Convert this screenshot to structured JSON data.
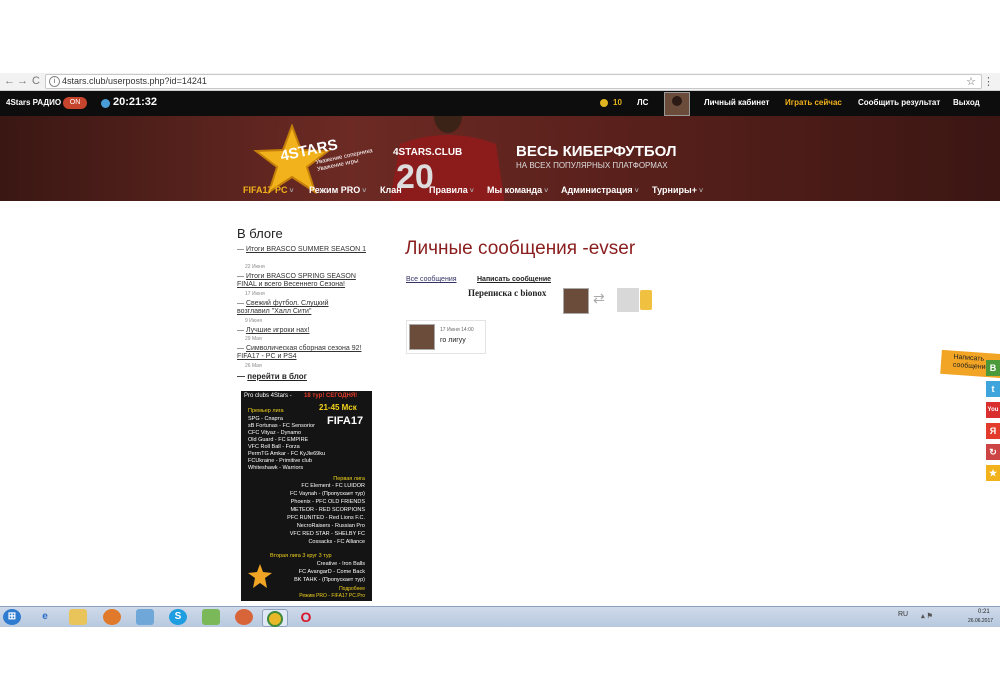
{
  "browser": {
    "url": "4stars.club/userposts.php?id=14241",
    "back": "←",
    "forward": "→",
    "reload": "C"
  },
  "topbar": {
    "radio_label": "4Stars РАДИО",
    "radio_button": "ON",
    "time": "20:21:32",
    "coins": "10",
    "ls": "ЛС",
    "nav": [
      "Личный кабинет",
      "Играть сейчас",
      "Сообщить результат",
      "Выход"
    ],
    "highlight_color": "#f2b21c"
  },
  "banner": {
    "logo": "4STARS",
    "slogan": [
      "Уважение соперника",
      "Уважение игры"
    ],
    "shirt_text": "4STARS.CLUB",
    "shirt_number": "20",
    "title": "ВЕСЬ КИБЕРФУТБОЛ",
    "subtitle": "НА ВСЕХ ПОПУЛЯРНЫХ ПЛАТФОРМАХ",
    "nav": [
      "FIFA17 PC",
      "Режим PRO",
      "Клан",
      "Правила",
      "Мы команда",
      "Администрация",
      "Турниры+"
    ],
    "active_color": "#f2b21c"
  },
  "sidebar": {
    "title": "В блоге",
    "items": [
      {
        "title": "Итоги BRASCO SUMMER SEASON 1",
        "date": "22 Июня"
      },
      {
        "title": "Итоги BRASCO SPRING SEASON FINAL и всего Весеннего Сезона!",
        "date": "17 Июня"
      },
      {
        "title": "Свежий футбол. Слуцкий возглавил \"Халл Сити\"",
        "date": "9 Июня"
      },
      {
        "title": "Лучшие игроки нах!",
        "date": "29 Мая"
      },
      {
        "title": "Символическая сборная сезона 92! FIFA17 - PC и PS4",
        "date": "26 Мая"
      }
    ],
    "to_blog": "перейти в блог"
  },
  "poster": {
    "header": "Pro clubs 4Stars -",
    "header_highlight": "18 тур! СЕГОДНЯ!",
    "time": "21-45 Мск",
    "game": "FIFA17",
    "premier_label": "Премьер лига",
    "premier": [
      "SPG - Спарта",
      "sB Fortunas - FC Sensorior",
      "CFC Vityaz - Dynamo",
      "Old Guard - FC EMPIRE",
      "VFC Roll Ball - Forza",
      "PermTG Amkar - FC KyJle69ku",
      "FCUkraine - Primitive club",
      "Whiteshawk - Warriors"
    ],
    "first_label": "Первая лига",
    "first": [
      "FC Element - FC LUIDOR",
      "FC Vaynah - (Пропускает тур)",
      "Phoenix - PFC OLD FRIENDS",
      "METEOR - RED SCORPIONS",
      "PFC RUNITED - Red Lions F.C.",
      "NecroRaisers - Russian Pro",
      "VFC RED STAR - SHELBY FC",
      "Cossacks - FC Alliance"
    ],
    "second_label": "Вторая лига  3 круг 3 тур",
    "second": [
      "Creative - Iron Balls",
      "FC AvangarD - Come Back",
      "BK TAHK - (Пропускает тур)"
    ],
    "footer1": "Подробнее",
    "footer2": "Режим PRO - FIFA17 PC.Pro"
  },
  "main": {
    "title": "Личные сообщения -evser",
    "tab_all": "Все сообщения",
    "tab_write": "Написать сообщение",
    "conversation_label": "Переписка с bionox",
    "message": {
      "date": "17 Июня 14:00",
      "text": "го лигуу"
    }
  },
  "feedback": {
    "label": "Написать сообщение"
  },
  "social": [
    "В",
    "t",
    "You",
    "Я",
    "↻",
    "★"
  ],
  "taskbar": {
    "lang": "RU",
    "time": "0:21",
    "date": "26.06.2017"
  }
}
